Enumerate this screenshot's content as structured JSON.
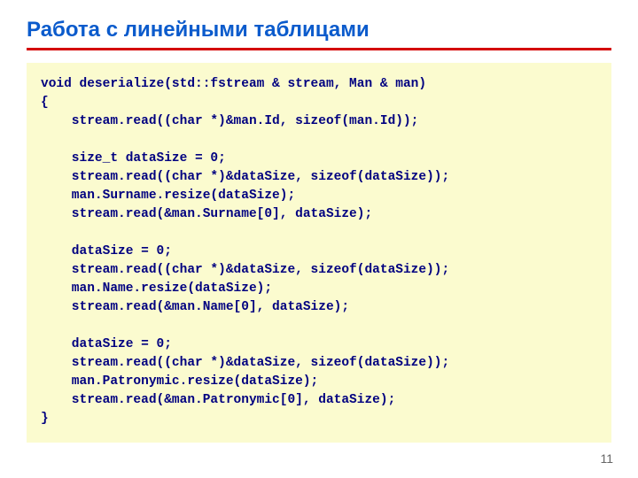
{
  "title": "Работа с линейными таблицами",
  "code": "void deserialize(std::fstream & stream, Man & man)\n{\n    stream.read((char *)&man.Id, sizeof(man.Id));\n\n    size_t dataSize = 0;\n    stream.read((char *)&dataSize, sizeof(dataSize));\n    man.Surname.resize(dataSize);\n    stream.read(&man.Surname[0], dataSize);\n\n    dataSize = 0;\n    stream.read((char *)&dataSize, sizeof(dataSize));\n    man.Name.resize(dataSize);\n    stream.read(&man.Name[0], dataSize);\n\n    dataSize = 0;\n    stream.read((char *)&dataSize, sizeof(dataSize));\n    man.Patronymic.resize(dataSize);\n    stream.read(&man.Patronymic[0], dataSize);\n}",
  "page_number": "11"
}
